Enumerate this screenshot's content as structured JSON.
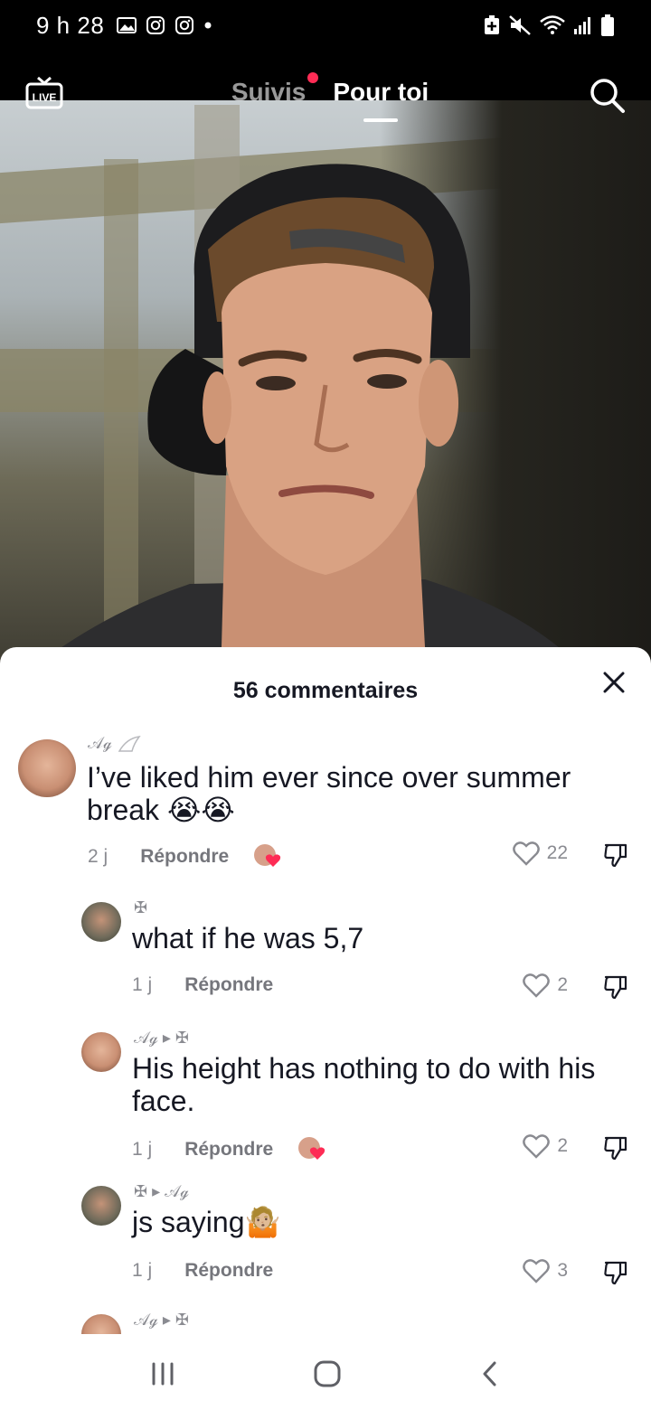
{
  "status_bar": {
    "time": "9 h 28"
  },
  "top_nav": {
    "tabs": [
      {
        "label": "Suivis",
        "active": false,
        "has_dot": true
      },
      {
        "label": "Pour toi",
        "active": true
      }
    ],
    "live_label": "LIVE"
  },
  "comments_sheet": {
    "title": "56 commentaires",
    "comments": [
      {
        "username": "𝒜ℊ",
        "text": "I’ve liked him ever since over summer break 😭😭",
        "time": "2 j",
        "reply_label": "Répondre",
        "likes": "22",
        "liked_by_creator": true
      },
      {
        "username": "✠",
        "text": "what if he was 5,7",
        "time": "1 j",
        "reply_label": "Répondre",
        "likes": "2",
        "reply_to": ""
      },
      {
        "username": "𝒜ℊ ▸ ✠",
        "text": "His height has nothing to do with his face.",
        "time": "1 j",
        "reply_label": "Répondre",
        "likes": "2",
        "liked_by_creator": true
      },
      {
        "username": "✠ ▸ 𝒜ℊ",
        "text": "js saying🤷🏼",
        "time": "1 j",
        "reply_label": "Répondre",
        "likes": "3"
      },
      {
        "username": "𝒜ℊ ▸ ✠"
      }
    ]
  },
  "colors": {
    "accent": "#fe2c55",
    "text": "#161823",
    "muted": "#8a8b91"
  }
}
